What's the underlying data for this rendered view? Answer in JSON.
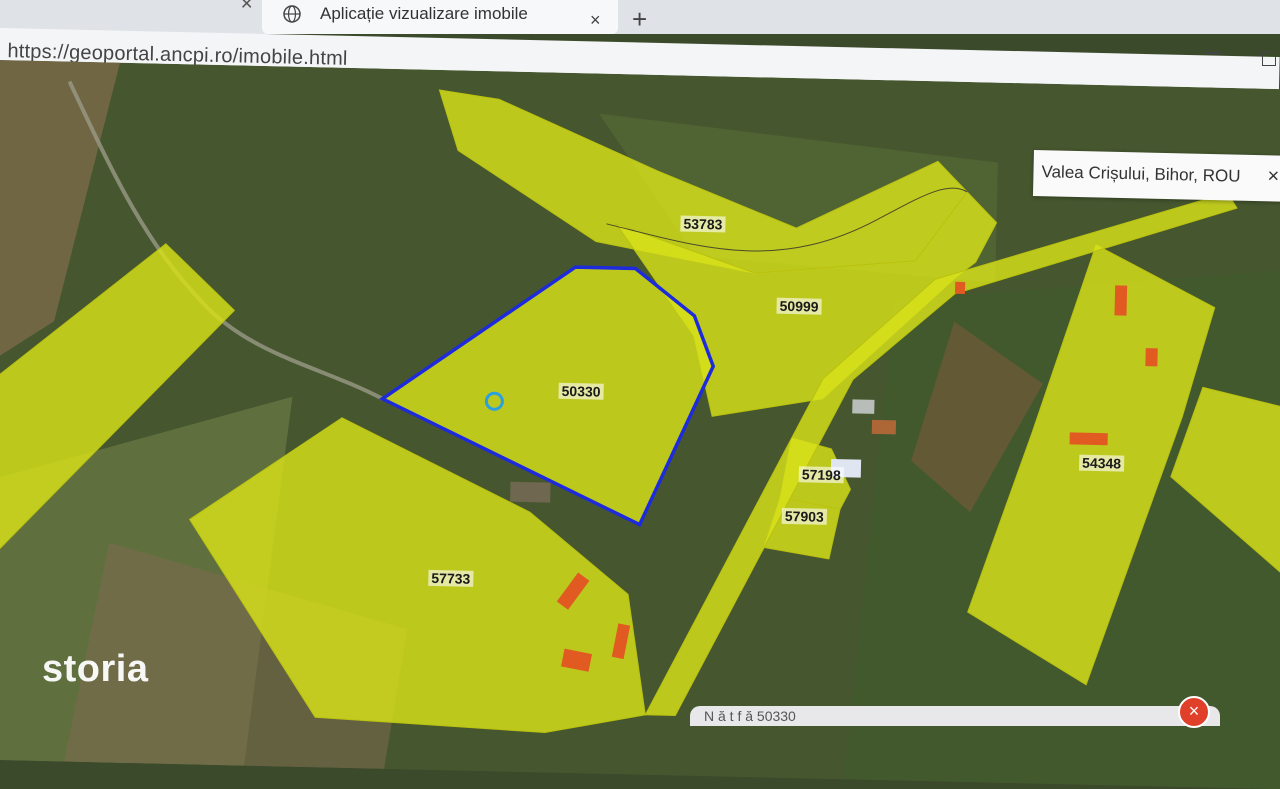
{
  "browser": {
    "tab_title": "Aplicație vizualizare imobile",
    "url": "https://geoportal.ancpi.ro/imobile.html",
    "tab_close": "×",
    "new_tab": "+"
  },
  "location_tooltip": {
    "text": "Valea Crișului, Bihor, ROU",
    "close": "×"
  },
  "parcels": [
    {
      "id": "53783",
      "label": "53783"
    },
    {
      "id": "50999",
      "label": "50999"
    },
    {
      "id": "50330",
      "label": "50330",
      "selected": true
    },
    {
      "id": "57198",
      "label": "57198"
    },
    {
      "id": "57903",
      "label": "57903"
    },
    {
      "id": "57733",
      "label": "57733"
    },
    {
      "id": "54348",
      "label": "54348"
    }
  ],
  "colors": {
    "parcel_fill": "#d8e21a",
    "selected_outline": "#1d2bdc",
    "marker": "#2aa0e0",
    "building": "#e05a22"
  },
  "bottom_bar": {
    "text": "N    ă       t    f         ă     50330",
    "close": "×"
  },
  "watermark": "storia"
}
